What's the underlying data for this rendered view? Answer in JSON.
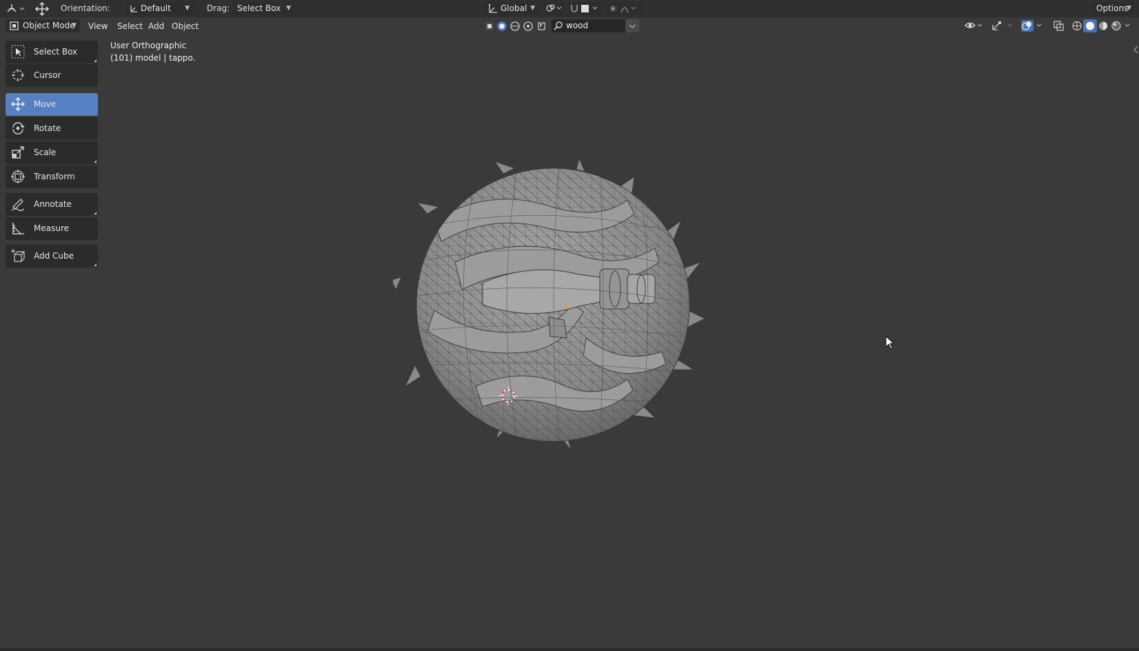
{
  "header": {
    "orientation_label": "Orientation:",
    "orientation_value": "Default",
    "drag_label": "Drag:",
    "drag_value": "Select Box",
    "transform_space": "Global",
    "options_label": "Options"
  },
  "menubar": {
    "mode": "Object Mode",
    "items": [
      "View",
      "Select",
      "Add",
      "Object"
    ],
    "search_value": "wood"
  },
  "toolbar": {
    "tools": [
      {
        "label": "Select Box",
        "icon": "select-box-icon",
        "active": false
      },
      {
        "label": "Cursor",
        "icon": "cursor-icon",
        "active": false
      },
      {
        "label": "Move",
        "icon": "move-icon",
        "active": true
      },
      {
        "label": "Rotate",
        "icon": "rotate-icon",
        "active": false
      },
      {
        "label": "Scale",
        "icon": "scale-icon",
        "active": false
      },
      {
        "label": "Transform",
        "icon": "transform-icon",
        "active": false
      },
      {
        "label": "Annotate",
        "icon": "annotate-icon",
        "active": false
      },
      {
        "label": "Measure",
        "icon": "measure-icon",
        "active": false
      },
      {
        "label": "Add Cube",
        "icon": "add-cube-icon",
        "active": false
      }
    ]
  },
  "viewport": {
    "view_name": "User Orthographic",
    "object_info": "(101) model | tappo."
  },
  "colors": {
    "active_tool": "#5680c2",
    "header_bg": "#303030",
    "viewport_bg": "#3a3a3a",
    "selection_accent": "#4772b3"
  }
}
